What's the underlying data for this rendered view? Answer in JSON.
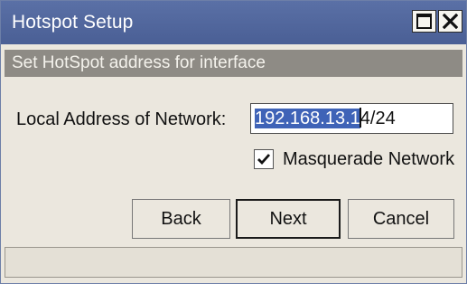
{
  "window": {
    "title": "Hotspot Setup",
    "accent_color": "#4f659c",
    "controls": [
      "maximize-icon",
      "close-icon"
    ]
  },
  "section": {
    "header": "Set HotSpot address for interface"
  },
  "form": {
    "address_label": "Local Address of Network:",
    "address_value_selected": "192.168.13.1",
    "address_value_rest": "4/24",
    "masquerade_label": "Masquerade Network",
    "masquerade_checked": true
  },
  "buttons": {
    "back": "Back",
    "next": "Next",
    "cancel": "Cancel"
  },
  "status": {
    "text": ""
  }
}
